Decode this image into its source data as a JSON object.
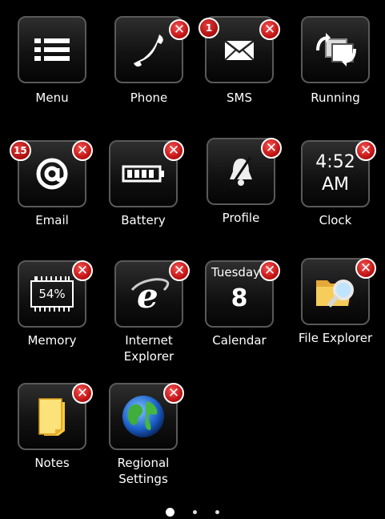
{
  "tiles": {
    "menu": {
      "label": "Menu",
      "icon": "menu-list-icon"
    },
    "phone": {
      "label": "Phone",
      "icon": "phone-icon"
    },
    "sms": {
      "label": "SMS",
      "icon": "envelope-icon",
      "badge": "1"
    },
    "running": {
      "label": "Running",
      "icon": "task-switch-icon"
    },
    "email": {
      "label": "Email",
      "icon": "at-sign-icon",
      "badge": "15"
    },
    "battery": {
      "label": "Battery",
      "icon": "battery-icon"
    },
    "profile": {
      "label": "Profile",
      "icon": "bell-muted-icon"
    },
    "clock": {
      "label": "Clock",
      "icon": "clock-icon",
      "time": "4:52",
      "ampm": "AM"
    },
    "memory": {
      "label": "Memory",
      "icon": "memory-chip-icon",
      "percent": "54%"
    },
    "ie": {
      "label": "Internet\nExplorer",
      "icon": "internet-explorer-icon"
    },
    "calendar": {
      "label": "Calendar",
      "icon": "calendar-icon",
      "day": "Tuesday",
      "date": "8"
    },
    "file_explorer": {
      "label": "File Explorer",
      "icon": "folder-search-icon"
    },
    "notes": {
      "label": "Notes",
      "icon": "notes-icon"
    },
    "regional": {
      "label": "Regional\nSettings",
      "icon": "globe-icon"
    }
  },
  "close_glyph": "✕",
  "pager": {
    "pages": 3,
    "current": 1
  }
}
